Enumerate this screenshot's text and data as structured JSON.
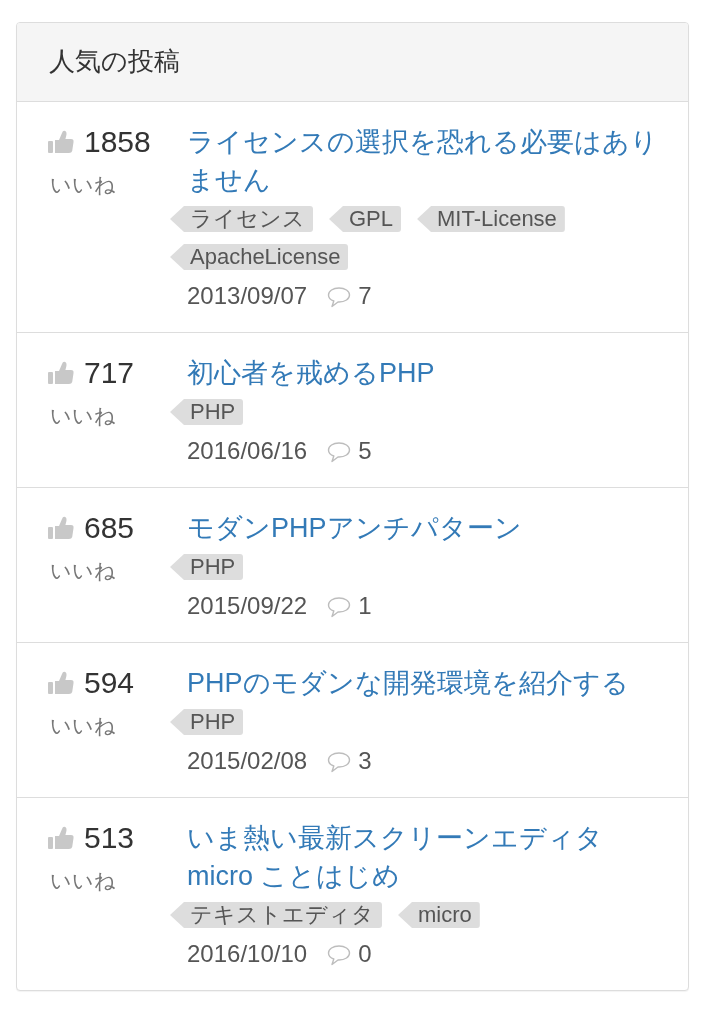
{
  "panel": {
    "title": "人気の投稿"
  },
  "posts": [
    {
      "likes": "1858",
      "likes_label": "いいね",
      "title": "ライセンスの選択を恐れる必要はありません",
      "tags": [
        "ライセンス",
        "GPL",
        "MIT-License",
        "ApacheLicense"
      ],
      "date": "2013/09/07",
      "comments": "7"
    },
    {
      "likes": "717",
      "likes_label": "いいね",
      "title": "初心者を戒めるPHP",
      "tags": [
        "PHP"
      ],
      "date": "2016/06/16",
      "comments": "5"
    },
    {
      "likes": "685",
      "likes_label": "いいね",
      "title": "モダンPHPアンチパターン",
      "tags": [
        "PHP"
      ],
      "date": "2015/09/22",
      "comments": "1"
    },
    {
      "likes": "594",
      "likes_label": "いいね",
      "title": "PHPのモダンな開発環境を紹介する",
      "tags": [
        "PHP"
      ],
      "date": "2015/02/08",
      "comments": "3"
    },
    {
      "likes": "513",
      "likes_label": "いいね",
      "title": "いま熱い最新スクリーンエディタ micro ことはじめ",
      "tags": [
        "テキストエディタ",
        "micro"
      ],
      "date": "2016/10/10",
      "comments": "0"
    }
  ]
}
